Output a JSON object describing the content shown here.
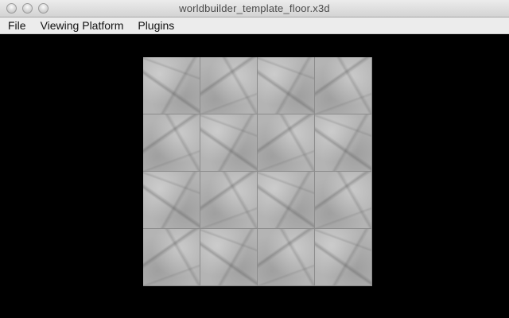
{
  "window": {
    "title": "worldbuilder_template_floor.x3d"
  },
  "menubar": {
    "items": [
      {
        "label": "File"
      },
      {
        "label": "Viewing Platform"
      },
      {
        "label": "Plugins"
      }
    ]
  },
  "viewport": {
    "background_color": "#000000",
    "floor": {
      "rows": 4,
      "columns": 4,
      "material": "marble-texture",
      "tile_color": "#b4b4b4",
      "grout_color": "#8c8c8c"
    }
  },
  "icons": {
    "close": "close-button-icon",
    "minimize": "minimize-button-icon",
    "zoom": "zoom-button-icon"
  }
}
